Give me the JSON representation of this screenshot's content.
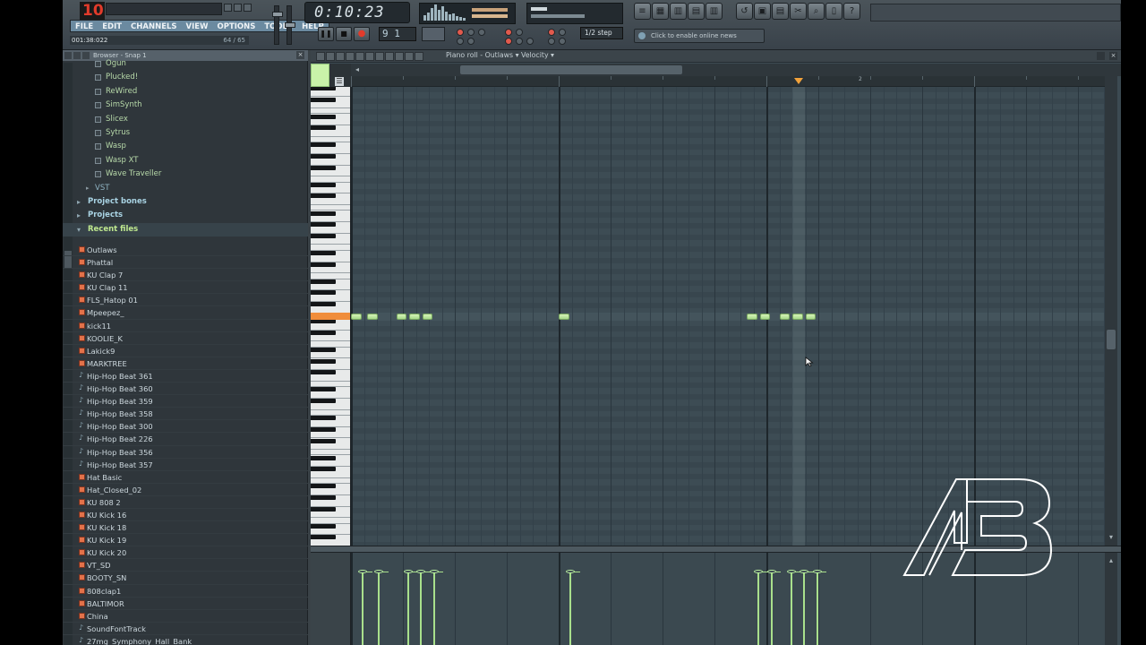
{
  "topbar": {
    "logo": "10",
    "time": "0:10:23",
    "menu": [
      "FILE",
      "EDIT",
      "CHANNELS",
      "VIEW",
      "OPTIONS",
      "TOOLS",
      "HELP"
    ],
    "hint_left": "001:38:022",
    "hint_right": "64 / 65",
    "pattern": "9 1",
    "snap": "1/2 step",
    "news": "Click to enable online news"
  },
  "browser": {
    "title": "Browser - Snap 1",
    "generators": [
      "Ogun",
      "Plucked!",
      "ReWired",
      "SimSynth",
      "Slicex",
      "Sytrus",
      "Wasp",
      "Wasp XT",
      "Wave Traveller"
    ],
    "vst_label": "VST",
    "folders": [
      "Project bones",
      "Projects",
      "Recent files"
    ],
    "recent_files": [
      {
        "name": "Outlaws",
        "type": "proj"
      },
      {
        "name": "Phattal",
        "type": "proj"
      },
      {
        "name": "KU Clap 7",
        "type": "proj"
      },
      {
        "name": "KU Clap 11",
        "type": "proj"
      },
      {
        "name": "FLS_Hatop 01",
        "type": "proj"
      },
      {
        "name": "Mpeepez_",
        "type": "proj"
      },
      {
        "name": "kick11",
        "type": "proj"
      },
      {
        "name": "KOOLIE_K",
        "type": "proj"
      },
      {
        "name": "Lakick9",
        "type": "proj"
      },
      {
        "name": "MARKTREE",
        "type": "proj"
      },
      {
        "name": "Hip-Hop Beat 361",
        "type": "wav"
      },
      {
        "name": "Hip-Hop Beat 360",
        "type": "wav"
      },
      {
        "name": "Hip-Hop Beat 359",
        "type": "wav"
      },
      {
        "name": "Hip-Hop Beat 358",
        "type": "wav"
      },
      {
        "name": "Hip-Hop Beat 300",
        "type": "wav"
      },
      {
        "name": "Hip-Hop Beat 226",
        "type": "wav"
      },
      {
        "name": "Hip-Hop Beat 356",
        "type": "wav"
      },
      {
        "name": "Hip-Hop Beat 357",
        "type": "wav"
      },
      {
        "name": "Hat Basic",
        "type": "proj"
      },
      {
        "name": "Hat_Closed_02",
        "type": "proj"
      },
      {
        "name": "KU 808 2",
        "type": "proj"
      },
      {
        "name": "KU Kick 16",
        "type": "proj"
      },
      {
        "name": "KU Kick 18",
        "type": "proj"
      },
      {
        "name": "KU Kick 19",
        "type": "proj"
      },
      {
        "name": "KU Kick 20",
        "type": "proj"
      },
      {
        "name": "VT_SD",
        "type": "proj"
      },
      {
        "name": "BOOTY_SN",
        "type": "proj"
      },
      {
        "name": "808clap1",
        "type": "proj"
      },
      {
        "name": "BALTIMOR",
        "type": "proj"
      },
      {
        "name": "China",
        "type": "proj"
      },
      {
        "name": "SoundFontTrack",
        "type": "wav"
      },
      {
        "name": "27mg_Symphony_Hall_Bank",
        "type": "wav"
      }
    ]
  },
  "piano_roll": {
    "title": "Piano roll - Outlaws",
    "target": "Velocity",
    "ruler_bar": "2",
    "notes_steps": [
      0.0,
      1.25,
      3.5,
      4.5,
      5.5,
      16.0,
      30.5,
      31.5,
      33.0,
      34.0,
      35.0
    ],
    "note_length_steps": 0.8,
    "note_row_fraction": 0.5,
    "playhead_step": 34.5,
    "colors": {
      "note": "#b9e69c",
      "playhead": "#f2a23b",
      "active_key": "#f08d3b",
      "grid": "#3d4c54"
    }
  },
  "watermark": "AB"
}
